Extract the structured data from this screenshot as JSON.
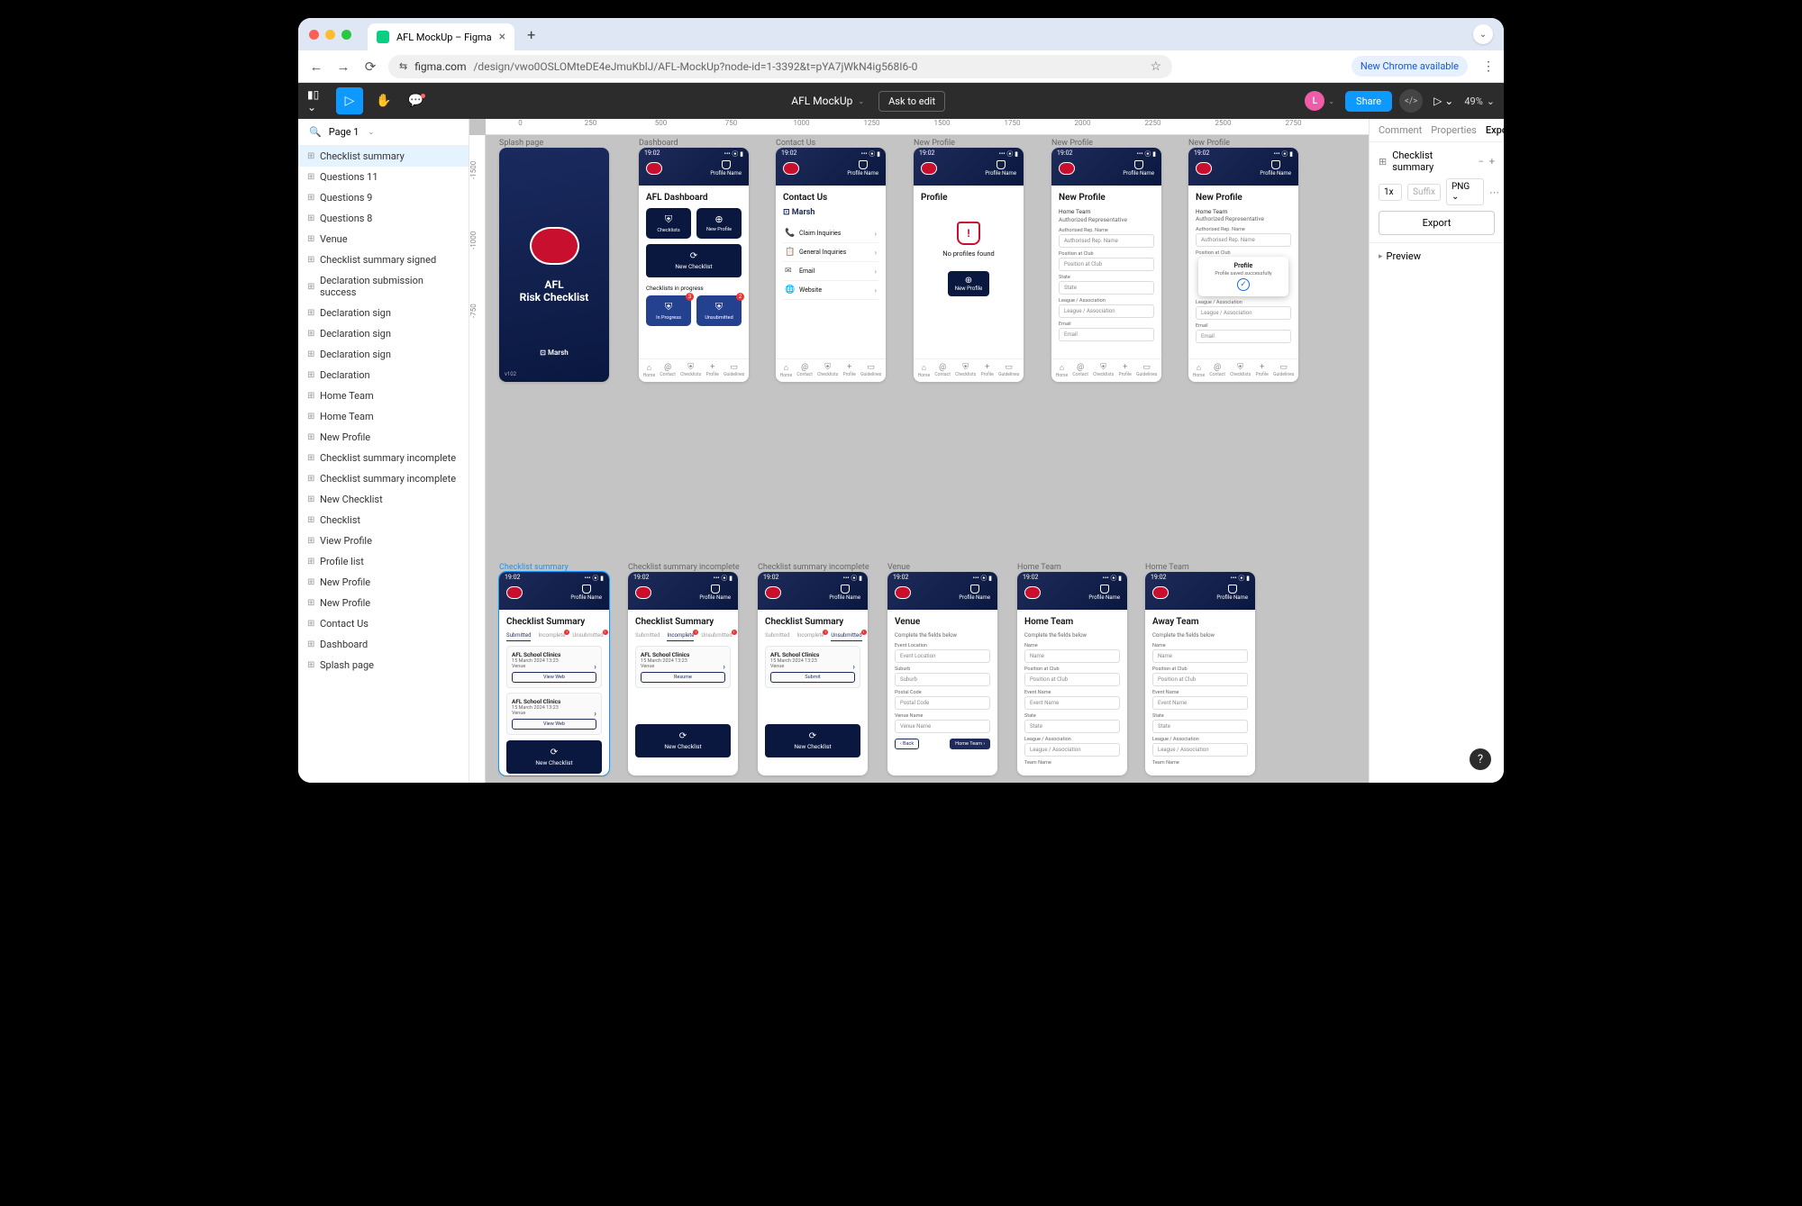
{
  "browser": {
    "tab_title": "AFL MockUp – Figma",
    "url_host": "figma.com",
    "url_path": "/design/vwo0OSLOMteDE4eJmuKblJ/AFL-MockUp?node-id=1-3392&t=pYA7jWkN4ig568I6-0",
    "chrome_update": "New Chrome available"
  },
  "figma": {
    "file_name": "AFL MockUp",
    "ask_to_edit": "Ask to edit",
    "share": "Share",
    "avatar": "L",
    "zoom": "49%",
    "page": "Page 1"
  },
  "layers": [
    "Checklist summary",
    "Questions 11",
    "Questions 9",
    "Questions 8",
    "Venue",
    "Checklist summary signed",
    "Declaration submission success",
    "Declaration sign",
    "Declaration sign",
    "Declaration sign",
    "Declaration",
    "Home Team",
    "Home Team",
    "New Profile",
    "Checklist summary incomplete",
    "Checklist summary incomplete",
    "New Checklist",
    "Checklist",
    "View Profile",
    "Profile list",
    "New Profile",
    "New Profile",
    "Contact Us",
    "Dashboard",
    "Splash page"
  ],
  "ruler_h": [
    "0",
    "250",
    "500",
    "750",
    "1000",
    "1250",
    "1500",
    "1750",
    "2000",
    "2250",
    "2500",
    "2750"
  ],
  "ruler_v": [
    "-1500",
    "-1000",
    "-750"
  ],
  "right_panel": {
    "tabs": [
      "Comment",
      "Properties",
      "Export"
    ],
    "header": "Checklist summary",
    "scale": "1x",
    "suffix": "Suffix",
    "format": "PNG",
    "export_btn": "Export",
    "preview": "Preview"
  },
  "frames": {
    "status_time": "19:02",
    "status_icons": "••• ⦿ ▮",
    "profile_name": "Profile Name",
    "nav": [
      "Home",
      "Contact",
      "Checklists",
      "Profile",
      "Guidelines"
    ],
    "row1_labels": [
      "Splash page",
      "Dashboard",
      "Contact Us",
      "New Profile",
      "New Profile",
      "New Profile"
    ],
    "splash": {
      "title": "AFL",
      "subtitle": "Risk Checklist",
      "marsh": "⊡ Marsh",
      "version": "v102"
    },
    "dashboard": {
      "title": "AFL Dashboard",
      "tile1": "Checklists",
      "tile2": "New Profile",
      "big": "New Checklist",
      "section": "Checklists in progress",
      "t3": "In Progress",
      "t3_badge": "3",
      "t4": "Unsubmitted",
      "t4_badge": "2"
    },
    "contact": {
      "title": "Contact Us",
      "marsh": "⊡ Marsh",
      "items": [
        "Claim Inquiries",
        "General Inquiries",
        "Email",
        "Website"
      ]
    },
    "profile": {
      "title": "Profile",
      "none": "No profiles found",
      "btn": "New Profile"
    },
    "newprofile": {
      "title": "New Profile",
      "sub1": "Home Team",
      "sub2": "Authorized Representative",
      "l1": "Authorised Rep. Name",
      "p1": "Authorised Rep. Name",
      "l2": "Position at Club",
      "p2": "Position at Club",
      "l3": "State",
      "p3": "State",
      "l4": "League / Association",
      "p4": "League / Association",
      "l5": "Email",
      "p5": "Email"
    },
    "modal": {
      "title": "Profile",
      "msg": "Profile saved successfully"
    },
    "row2_labels": [
      "Checklist summary",
      "Checklist summary incomplete",
      "Checklist summary incomplete",
      "Venue",
      "Home Team",
      "Home Team"
    ],
    "summary": {
      "title": "Checklist Summary",
      "tabs": [
        "Submitted",
        "Incomplete",
        "Unsubmitted"
      ],
      "item_title": "AFL School Clinics",
      "item_date": "15 March 2024 13:23",
      "item_loc": "Venue",
      "view_web": "View Web",
      "resume": "Resume",
      "submit": "Submit",
      "new_checklist": "New Checklist"
    },
    "venue": {
      "title": "Venue",
      "subtitle": "Complete the fields below",
      "l1": "Event Location",
      "p1": "Event Location",
      "l2": "Suburb",
      "p2": "Suburb",
      "l3": "Postal Code",
      "p3": "Postal Code",
      "l4": "Venue Name",
      "p4": "Venue Name",
      "back": "Back",
      "next": "Home Team"
    },
    "team": {
      "title_home": "Home Team",
      "title_away": "Away Team",
      "subtitle": "Complete the fields below",
      "l1": "Name",
      "p1": "Name",
      "l2": "Position at Club",
      "p2": "Position at Club",
      "l3": "Event Name",
      "p3": "Event Name",
      "l4": "State",
      "p4": "State",
      "l5": "League / Association",
      "p5": "League / Association",
      "l6": "Team Name"
    }
  }
}
